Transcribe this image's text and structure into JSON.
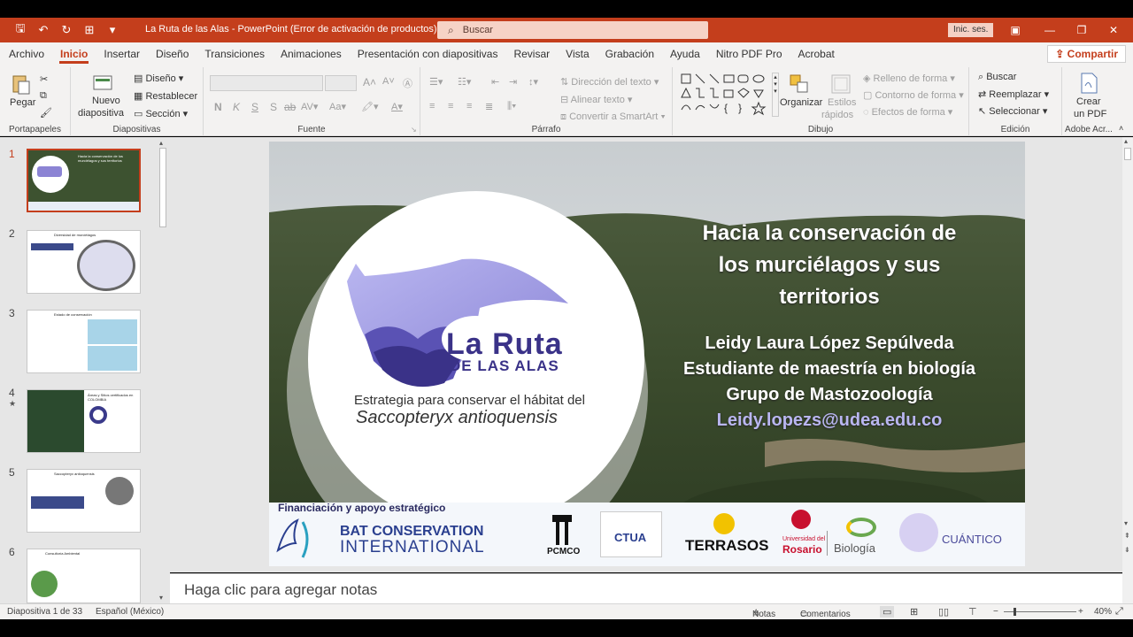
{
  "window": {
    "title": "La Ruta de las Alas  -  PowerPoint (Error de activación de productos)",
    "search_placeholder": "Buscar",
    "signin": "Inic. ses."
  },
  "menu": {
    "tabs": [
      "Archivo",
      "Inicio",
      "Insertar",
      "Diseño",
      "Transiciones",
      "Animaciones",
      "Presentación con diapositivas",
      "Revisar",
      "Vista",
      "Grabación",
      "Ayuda",
      "Nitro PDF Pro",
      "Acrobat"
    ],
    "share": "Compartir"
  },
  "ribbon": {
    "portapapeles": {
      "paste": "Pegar",
      "label": "Portapapeles"
    },
    "diapositivas": {
      "new1": "Nuevo",
      "new2": "diapositiva",
      "layout": "Diseño",
      "reset": "Restablecer",
      "section": "Sección",
      "label": "Diapositivas"
    },
    "fuente": {
      "label": "Fuente",
      "bold": "N",
      "italic": "K",
      "underline": "S",
      "strike": "S",
      "case": "Aa"
    },
    "parrafo": {
      "dir": "Dirección del texto",
      "align": "Alinear texto",
      "smartart": "Convertir a SmartArt",
      "label": "Párrafo"
    },
    "dibujo": {
      "organize": "Organizar",
      "styles1": "Estilos",
      "styles2": "rápidos",
      "fill": "Relleno de forma",
      "outline": "Contorno de forma",
      "effects": "Efectos de forma",
      "label": "Dibujo"
    },
    "edicion": {
      "find": "Buscar",
      "replace": "Reemplazar",
      "select": "Seleccionar",
      "label": "Edición"
    },
    "adobe": {
      "create1": "Crear",
      "create2": "un PDF",
      "label": "Adobe Acr..."
    }
  },
  "thumbnails": [
    {
      "num": "1",
      "title": "Hacia la conservación de los murciélagos y sus territorios"
    },
    {
      "num": "2",
      "title": "Diversidad de murciélagos"
    },
    {
      "num": "3",
      "title": "Estado de conservación"
    },
    {
      "num": "4",
      "title": "Áreas y Sitios certificados en COLOMBIA"
    },
    {
      "num": "5",
      "title": "Saccopteryx antioquensis"
    },
    {
      "num": "6",
      "title": "Consultoría Ambiental"
    }
  ],
  "slide": {
    "logo_line1": "La Ruta",
    "logo_line2": "DE LAS ALAS",
    "strategy": "Estrategia para conservar el hábitat del",
    "species": "Saccopteryx antioquensis",
    "title_l1": "Hacia la conservación de",
    "title_l2": "los murciélagos y sus",
    "title_l3": "territorios",
    "author": "Leidy Laura López Sepúlveda",
    "role": "Estudiante de maestría en biología",
    "group": "Grupo de Mastozoología",
    "email": "Leidy.lopezs@udea.edu.co",
    "funding": "Financiación y apoyo estratégico",
    "sponsors": {
      "bci1": "BAT CONSERVATION",
      "bci2": "INTERNATIONAL",
      "pcmco": "PCMCO",
      "ctua": "CTUA",
      "terrasos": "TERRASOS",
      "rosario1": "Universidad del",
      "rosario2": "Rosario",
      "biologia": "Biología",
      "cuantico": "CUÁNTICO"
    }
  },
  "notes_placeholder": "Haga clic para agregar notas",
  "status": {
    "slide": "Diapositiva 1 de 33",
    "lang": "Español (México)",
    "notes": "Notas",
    "comments": "Comentarios",
    "zoom": "40%"
  },
  "colors": {
    "accent": "#c43e1c",
    "email": "#b9b6f0",
    "bci": "#2a3f8f"
  }
}
